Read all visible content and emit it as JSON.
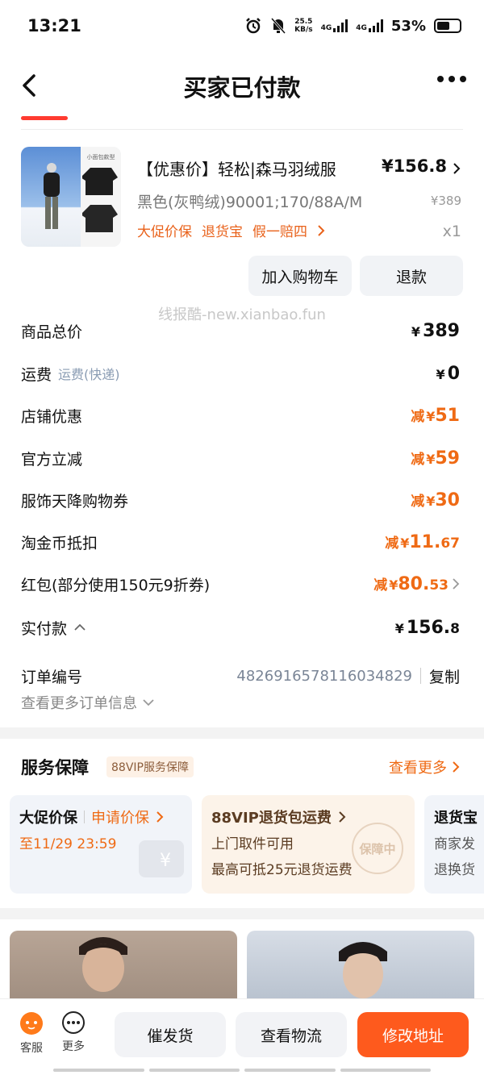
{
  "status": {
    "time": "13:21",
    "speed_top": "25.5",
    "speed_bottom": "KB/s",
    "net1": "4G",
    "net2": "4G",
    "battery": "53%"
  },
  "nav": {
    "title": "买家已付款"
  },
  "product": {
    "name": "【优惠价】轻松|森马羽绒服",
    "price": "¥156.8",
    "sku": "黑色(灰鸭绒)90001;170/88A/M",
    "original_price": "¥389",
    "tags": [
      "大促价保",
      "退货宝",
      "假一赔四"
    ],
    "qty": "x1",
    "thumb_text": "小面包款型"
  },
  "actions": {
    "add_cart": "加入购物车",
    "refund": "退款"
  },
  "watermark": "线报酷-new.xianbao.fun",
  "summary": {
    "total_label": "商品总价",
    "total_value": "389",
    "shipping_label": "运费",
    "shipping_sub": "运费(快递)",
    "shipping_value": "0",
    "shop_label": "店铺优惠",
    "shop_value": "51",
    "official_label": "官方立减",
    "official_value": "59",
    "coupon_label": "服饰天降购物券",
    "coupon_value": "30",
    "coin_label": "淘金币抵扣",
    "coin_int": "11.",
    "coin_dec": "67",
    "redpack_label": "红包(部分使用150元9折券)",
    "redpack_int": "80.",
    "redpack_dec": "53",
    "paid_label": "实付款",
    "paid_int": "156.",
    "paid_dec": "8",
    "reduce_prefix": "减",
    "yen": "¥"
  },
  "order": {
    "no_label": "订单编号",
    "no_value": "4826916578116034829",
    "copy": "复制",
    "more_info": "查看更多订单信息"
  },
  "service": {
    "title": "服务保障",
    "badge": "88VIP服务保障",
    "more": "查看更多",
    "boxes": [
      {
        "head": "大促价保",
        "head_action": "申请价保",
        "line1": "至11/29 23:59",
        "line2": ""
      },
      {
        "head": "88VIP退货包运费",
        "head_action": "",
        "line1": "上门取件可用",
        "line2": "最高可抵25元退货运费",
        "stamp": "保障中"
      },
      {
        "head": "退货宝",
        "head_action": "",
        "line1": "商家发",
        "line2": "退换货"
      }
    ]
  },
  "bottom": {
    "service": "客服",
    "more": "更多",
    "urge": "催发货",
    "logistics": "查看物流",
    "change_address": "修改地址"
  },
  "colors": {
    "accent": "#ef6a14",
    "primary_button": "#fe5a1d",
    "red_tab": "#ff3b30"
  }
}
